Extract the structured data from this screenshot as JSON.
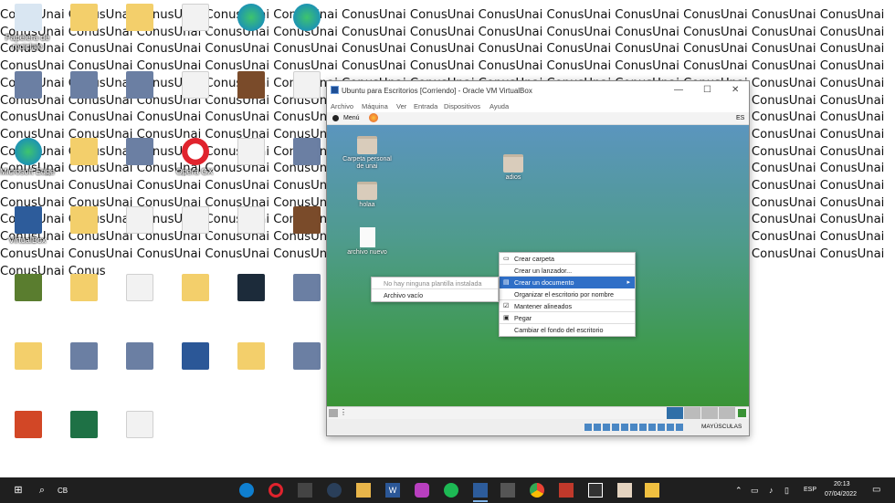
{
  "wallpaper": {
    "repeated_text": "ConusUnai ConusUnai ConusUnai ConusUnai ConusUnai ConusUnai ConusUnai ConusUnai ConusUnai ConusUnai ConusUnai ConusUnai ConusUnai ConusUnai ConusUnai ConusUnai ConusUnai ConusUnai ConusUnai ConusUnai ConusUnai ConusUnai ConusUnai ConusUnai ConusUnai ConusUnai ConusUnai ConusUnai ConusUnai ConusUnai ConusUnai ConusUnai ConusUnai ConusUnai ConusUnai ConusUnai ConusUnai ConusUnai ConusUnai ConusUnai ConusUnai ConusUnai ConusUnai ConusUnai ConusUnai ConusUnai ConusUnai ConusUnai ConusUnai ConusUnai ConusUnai ConusUnai ConusUnai ConusUnai ConusUnai ConusUnai ConusUnai ConusUnai ConusUnai ConusUnai ConusUnai ConusUnai ConusUnai ConusUnai ConusUnai ConusUnai ConusUnai ConusUnai ConusUnai ConusUnai ConusUnai ConusUnai ConusUnai ConusUnai ConusUnai ConusUnai ConusUnai ConusUnai ConusUnai ConusUnai ConusUnai ConusUnai ConusUnai ConusUnai ConusUnai ConusUnai ConusUnai ConusUnai ConusUnai ConusUnai ConusUnai ConusUnai ConusUnai ConusUnai ConusUnai ConusUnai ConusUnai ConusUnai ConusUnai ConusUnai ConusUnai ConusUnai ConusUnai ConusUnai ConusUnai ConusUnai ConusUnai ConusUnai ConusUnai ConusUnai ConusUnai ConusUnai ConusUnai ConusUnai ConusUnai ConusUnai ConusUnai ConusUnai ConusUnai ConusUnai ConusUnai ConusUnai ConusUnai ConusUnai ConusUnai ConusUnai ConusUnai ConusUnai ConusUnai ConusUnai ConusUnai ConusUnai ConusUnai ConusUnai ConusUnai ConusUnai ConusUnai ConusUnai ConusUnai ConusUnai ConusUnai ConusUnai ConusUnai ConusUnai ConusUnai ConusUnai ConusUnai ConusUnai ConusUnai ConusUnai ConusUnai ConusUnai ConusUnai ConusUnai ConusUnai ConusUnai ConusUnai ConusUnai ConusUnai ConusUnai ConusUnai ConusUnai ConusUnai ConusUnai ConusUnai ConusUnai ConusUnai ConusUnai ConusUnai ConusUnai ConusUnai ConusUnai ConusUnai ConusUnai ConusUnai ConusUnai ConusUnai ConusUnai ConusUnai ConusUnai ConusUnai ConusUnai ConusUnai ConusUnai ConusUnai ConusUnai ConusUnai ConusUnai ConusUnai ConusUnai ConusUnai ConusUnai ConusUnai ConusUnai ConusUnai ConusUnai Conus"
  },
  "desktop_icons": [
    {
      "label": "Papelera de reciclaje",
      "icon": "recycle-bin-icon"
    },
    {
      "label": "",
      "icon": "folder-icon"
    },
    {
      "label": "",
      "icon": "folder-icon"
    },
    {
      "label": "",
      "icon": "document-icon"
    },
    {
      "label": "",
      "icon": "edge-icon"
    },
    {
      "label": "",
      "icon": "edge-icon"
    },
    {
      "label": "",
      "icon": "app-icon"
    },
    {
      "label": "",
      "icon": "app-icon"
    },
    {
      "label": "",
      "icon": "app-icon"
    },
    {
      "label": "",
      "icon": "document-icon"
    },
    {
      "label": "",
      "icon": "game-icon"
    },
    {
      "label": "",
      "icon": "document-icon"
    },
    {
      "label": "Microsoft Edge",
      "icon": "edge-icon"
    },
    {
      "label": "",
      "icon": "folder-icon"
    },
    {
      "label": "",
      "icon": "app-icon"
    },
    {
      "label": "Opera GX",
      "icon": "opera-icon"
    },
    {
      "label": "",
      "icon": "document-icon"
    },
    {
      "label": "",
      "icon": "app-icon"
    },
    {
      "label": "VirtualBox",
      "icon": "virtualbox-icon"
    },
    {
      "label": "",
      "icon": "folder-icon"
    },
    {
      "label": "",
      "icon": "document-icon"
    },
    {
      "label": "",
      "icon": "document-icon"
    },
    {
      "label": "",
      "icon": "document-icon"
    },
    {
      "label": "",
      "icon": "game-icon"
    },
    {
      "label": "",
      "icon": "minecraft-icon"
    },
    {
      "label": "",
      "icon": "folder-icon"
    },
    {
      "label": "",
      "icon": "document-icon"
    },
    {
      "label": "",
      "icon": "folder-icon"
    },
    {
      "label": "",
      "icon": "filmora-icon"
    },
    {
      "label": "",
      "icon": "app-icon"
    },
    {
      "label": "",
      "icon": "folder-icon"
    },
    {
      "label": "",
      "icon": "app-icon"
    },
    {
      "label": "",
      "icon": "app-icon"
    },
    {
      "label": "",
      "icon": "word-icon"
    },
    {
      "label": "",
      "icon": "folder-icon"
    },
    {
      "label": "",
      "icon": "app-icon"
    },
    {
      "label": "",
      "icon": "powerpoint-icon"
    },
    {
      "label": "",
      "icon": "excel-icon"
    },
    {
      "label": "",
      "icon": "document-icon"
    }
  ],
  "vbox": {
    "title": "Ubuntu para Escritorios [Corriendo] - Oracle VM VirtualBox",
    "controls": {
      "minimize": "—",
      "maximize": "☐",
      "close": "✕"
    },
    "menu": [
      "Archivo",
      "Máquina",
      "Ver",
      "Entrada",
      "Dispositivos",
      "Ayuda"
    ],
    "panel": {
      "menu_label": "Menú",
      "lang": "ES"
    },
    "guest_icons": [
      {
        "label": "Carpeta personal de unai",
        "kind": "home"
      },
      {
        "label": "holaa",
        "kind": "folder"
      },
      {
        "label": "archivo nuevo",
        "kind": "document"
      },
      {
        "label": "adios",
        "kind": "folder"
      }
    ],
    "context_menu": [
      {
        "label": "Crear carpeta",
        "icon": "folder-add-icon"
      },
      {
        "label": "Crear un lanzador...",
        "icon": ""
      },
      {
        "label": "Crear un documento",
        "icon": "document-add-icon",
        "highlighted": true,
        "submenu": true
      },
      {
        "label": "Organizar el escritorio por nombre",
        "icon": ""
      },
      {
        "label": "Mantener alineados",
        "icon": "check-icon",
        "checked": true
      },
      {
        "label": "Pegar",
        "icon": "paste-icon"
      },
      {
        "label": "Cambiar el fondo del escritorio",
        "icon": ""
      }
    ],
    "submenu": [
      {
        "label": "No hay ninguna plantilla instalada",
        "disabled": true
      },
      {
        "label": "Archivo vacío",
        "icon": "document-icon"
      }
    ],
    "status_text": "MAYÚSCULAS"
  },
  "taskbar": {
    "search_label": "CB",
    "language": "ESP",
    "time": "20:13",
    "date": "07/04/2022",
    "accent": "#1f1f1f"
  }
}
